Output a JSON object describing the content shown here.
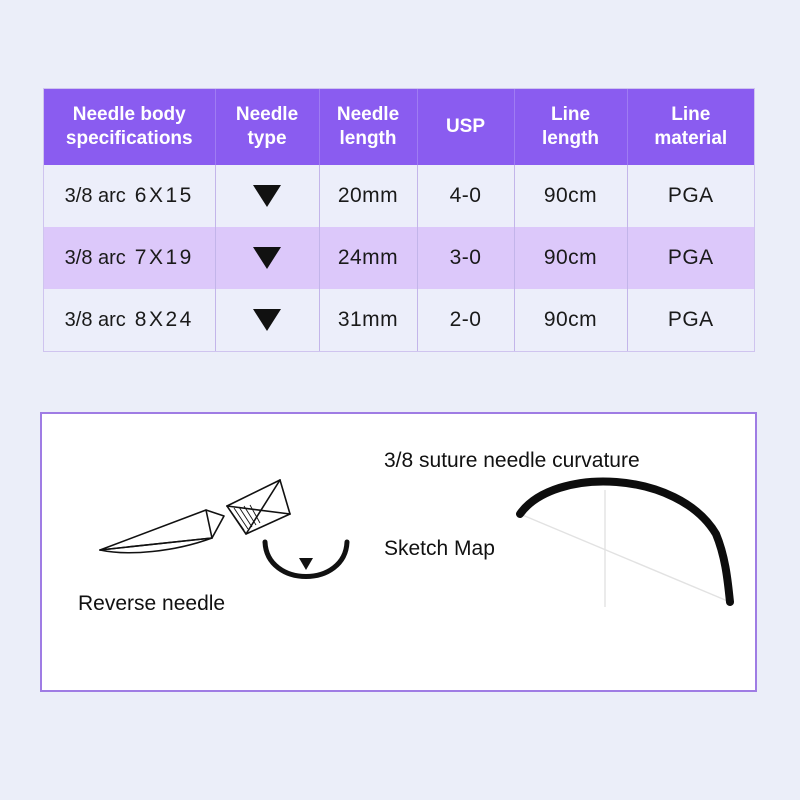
{
  "table": {
    "headers": [
      "Needle body specifications",
      "Needle type",
      "Needle length",
      "USP",
      "Line length",
      "Line material"
    ],
    "header_lines": {
      "col0_line1": "Needle body",
      "col0_line2": "specifications",
      "col1_line1": "Needle",
      "col1_line2": "type",
      "col2_line1": "Needle",
      "col2_line2": "length",
      "col3": "USP",
      "col4": "Line length",
      "col5": "Line material"
    },
    "rows": [
      {
        "arc": "3/8 arc",
        "size": "6X15",
        "needle_type": "reverse-cutting-triangle",
        "needle_length": "20mm",
        "usp": "4-0",
        "line_length": "90cm",
        "line_material": "PGA",
        "highlighted": false
      },
      {
        "arc": "3/8 arc",
        "size": "7X19",
        "needle_type": "reverse-cutting-triangle",
        "needle_length": "24mm",
        "usp": "3-0",
        "line_length": "90cm",
        "line_material": "PGA",
        "highlighted": true
      },
      {
        "arc": "3/8 arc",
        "size": "8X24",
        "needle_type": "reverse-cutting-triangle",
        "needle_length": "31mm",
        "usp": "2-0",
        "line_length": "90cm",
        "line_material": "PGA",
        "highlighted": false
      }
    ]
  },
  "sketch": {
    "reverse_needle_label": "Reverse needle",
    "curvature_label": "3/8 suture needle curvature",
    "sketch_map_label": "Sketch Map"
  },
  "colors": {
    "page_background": "#ebeef9",
    "header_purple": "#8a5cf0",
    "row_plain": "#eceefa",
    "row_highlight": "#dcc8fa",
    "grid_line": "#c3b5ea",
    "panel_border": "#9f7ce4",
    "ink": "#111111"
  }
}
